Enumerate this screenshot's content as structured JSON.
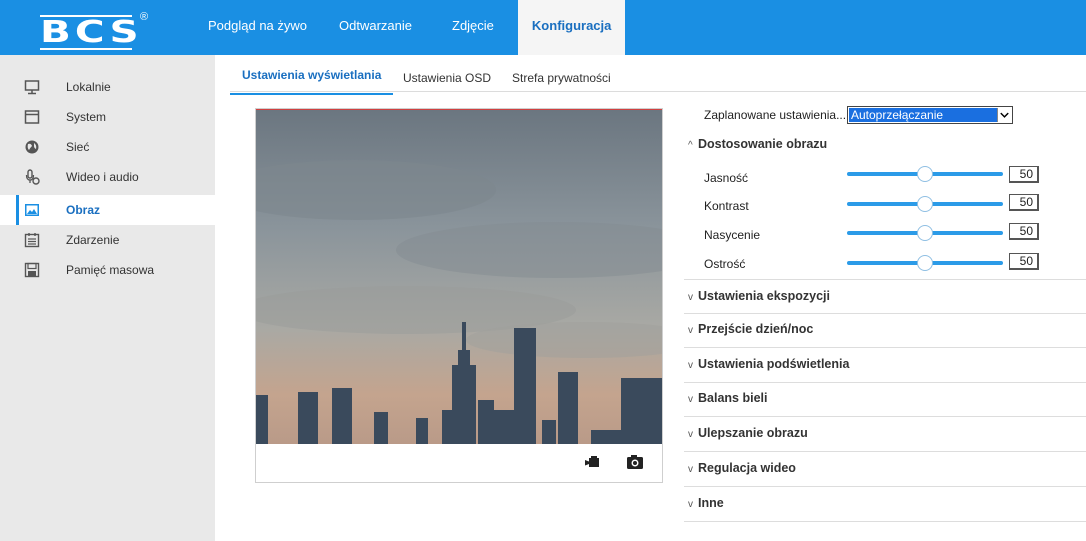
{
  "brand": {
    "logo_text": "BCS",
    "registered": "®"
  },
  "nav": {
    "items": [
      {
        "label": "Podgląd na żywo"
      },
      {
        "label": "Odtwarzanie"
      },
      {
        "label": "Zdjęcie"
      },
      {
        "label": "Konfiguracja"
      }
    ],
    "active_index": 3
  },
  "sidebar": {
    "items": [
      {
        "label": "Lokalnie",
        "icon": "monitor-icon"
      },
      {
        "label": "System",
        "icon": "window-icon"
      },
      {
        "label": "Sieć",
        "icon": "globe-icon"
      },
      {
        "label": "Wideo i audio",
        "icon": "microphone-icon"
      },
      {
        "label": "Obraz",
        "icon": "image-icon"
      },
      {
        "label": "Zdarzenie",
        "icon": "calendar-icon"
      },
      {
        "label": "Pamięć masowa",
        "icon": "storage-icon"
      }
    ],
    "active_index": 4
  },
  "tabs": [
    {
      "label": "Ustawienia wyświetlania"
    },
    {
      "label": "Ustawienia OSD"
    },
    {
      "label": "Strefa prywatności"
    }
  ],
  "video": {
    "record_icon": "video-record-icon",
    "snapshot_icon": "camera-snapshot-icon"
  },
  "schedule": {
    "label": "Zaplanowane ustawienia...",
    "value": "Autoprzełączanie"
  },
  "image_adjust": {
    "title": "Dostosowanie obrazu",
    "sliders": [
      {
        "label": "Jasność",
        "value": "50",
        "level": 50
      },
      {
        "label": "Kontrast",
        "value": "50",
        "level": 50
      },
      {
        "label": "Nasycenie",
        "value": "50",
        "level": 50
      },
      {
        "label": "Ostrość",
        "value": "50",
        "level": 50
      }
    ]
  },
  "sections": [
    {
      "title": "Ustawienia ekspozycji"
    },
    {
      "title": "Przejście dzień/noc"
    },
    {
      "title": "Ustawienia podświetlenia"
    },
    {
      "title": "Balans bieli"
    },
    {
      "title": "Ulepszanie obrazu"
    },
    {
      "title": "Regulacja wideo"
    },
    {
      "title": "Inne"
    }
  ],
  "colors": {
    "accent": "#1a8fe3",
    "sidebar_bg": "#e9e9e9",
    "select_highlight": "#1a6fe0"
  }
}
